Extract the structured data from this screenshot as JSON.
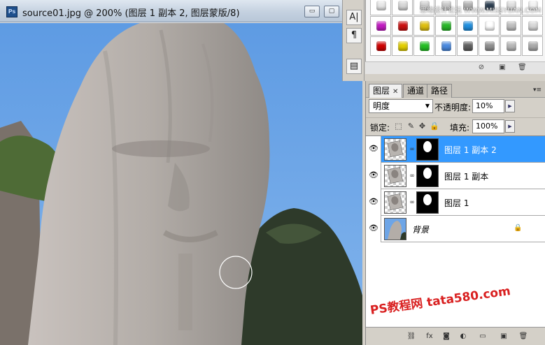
{
  "document": {
    "title": "source01.jpg @ 200% (图层 1 副本 2, 图层蒙版/8)",
    "ps_icon": "Ps",
    "buttons": {
      "minimize": "▭",
      "maximize": "▢"
    }
  },
  "vstrip": {
    "character_icon": "A|",
    "paragraph_icon": "¶",
    "notes_icon": "▤"
  },
  "styles_panel": {
    "swatch_colors": [
      [
        "#e8e8e8",
        "#d8d8d8",
        "#cfcfcf",
        "#c9c9c9",
        "#b0b0b0",
        "#2c3e50",
        "#e0e0e0",
        "#f2f2f2"
      ],
      [
        "#c21ac2",
        "#cc1111",
        "#e0c010",
        "#28b828",
        "#2090e0",
        "#ffffff",
        "#c0c0c0",
        "#d8d8d8"
      ],
      [
        "#d00000",
        "#e4d000",
        "#22c022",
        "#4a8ae0",
        "#606060",
        "#909090",
        "#b8b8b8",
        "#aaaaaa"
      ]
    ],
    "footer_icons": [
      "no-icon",
      "new-icon",
      "delete-icon"
    ],
    "watermark": "思缘设计论坛 WWW.MISSYUAN.COM"
  },
  "layers_panel": {
    "tabs": [
      {
        "label": "图层",
        "active": true,
        "close": "✕"
      },
      {
        "label": "通道",
        "active": false
      },
      {
        "label": "路径",
        "active": false
      }
    ],
    "menu_icon": "▾≡",
    "blend_mode": "明度",
    "opacity_label": "不透明度:",
    "opacity_value": "10%",
    "lock_label": "锁定:",
    "fill_label": "填充:",
    "fill_value": "100%",
    "layers": [
      {
        "name": "图层 1 副本 2",
        "selected": true,
        "has_mask": true
      },
      {
        "name": "图层 1 副本",
        "selected": false,
        "has_mask": true
      },
      {
        "name": "图层 1",
        "selected": false,
        "has_mask": true
      },
      {
        "name": "背景",
        "selected": false,
        "has_mask": false,
        "locked": true
      }
    ],
    "watermark": "PS教程网 tata580.com"
  },
  "colors": {
    "selection": "#3399ff",
    "sky": "#6da5e7",
    "rock": "#b8b4b0"
  }
}
